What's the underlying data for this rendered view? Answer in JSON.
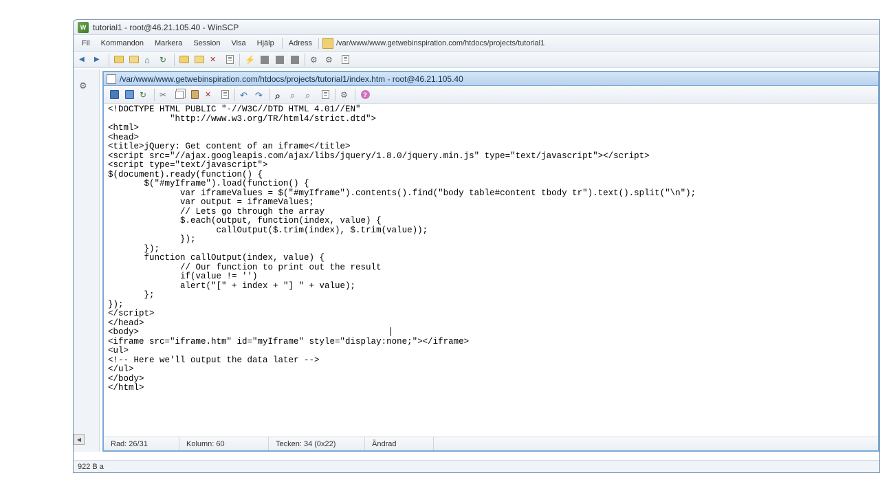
{
  "window": {
    "title": "tutorial1 - root@46.21.105.40 - WinSCP"
  },
  "menubar": {
    "items": [
      "Fil",
      "Kommandon",
      "Markera",
      "Session",
      "Visa",
      "Hjälp"
    ],
    "address_label": "Adress",
    "address_path": "/var/www/www.getwebinspiration.com/htdocs/projects/tutorial1"
  },
  "main_status": {
    "size": "922 B a"
  },
  "editor": {
    "title": "/var/www/www.getwebinspiration.com/htdocs/projects/tutorial1/index.htm - root@46.21.105.40",
    "code": "<!DOCTYPE HTML PUBLIC \"-//W3C//DTD HTML 4.01//EN\"\n            \"http://www.w3.org/TR/html4/strict.dtd\">\n<html>\n<head>\n<title>jQuery: Get content of an iframe</title>\n<script src=\"//ajax.googleapis.com/ajax/libs/jquery/1.8.0/jquery.min.js\" type=\"text/javascript\"></script>\n<script type=\"text/javascript\">\n$(document).ready(function() {\n       $(\"#myIframe\").load(function() {\n              var iframeValues = $(\"#myIframe\").contents().find(\"body table#content tbody tr\").text().split(\"\\n\");\n              var output = iframeValues;\n              // Lets go through the array\n              $.each(output, function(index, value) {\n                     callOutput($.trim(index), $.trim(value));\n              });\n       });\n       function callOutput(index, value) {\n              // Our function to print out the result\n              if(value != '')\n              alert(\"[\" + index + \"] \" + value);\n       };\n});\n</script>\n</head>\n<body>\n<iframe src=\"iframe.htm\" id=\"myIframe\" style=\"display:none;\"></iframe>\n<ul>\n<!-- Here we'll output the data later -->\n</ul>\n</body>\n</html>",
    "status": {
      "row": "Rad: 26/31",
      "col": "Kolumn: 60",
      "char": "Tecken: 34 (0x22)",
      "mod": "Ändrad"
    }
  }
}
